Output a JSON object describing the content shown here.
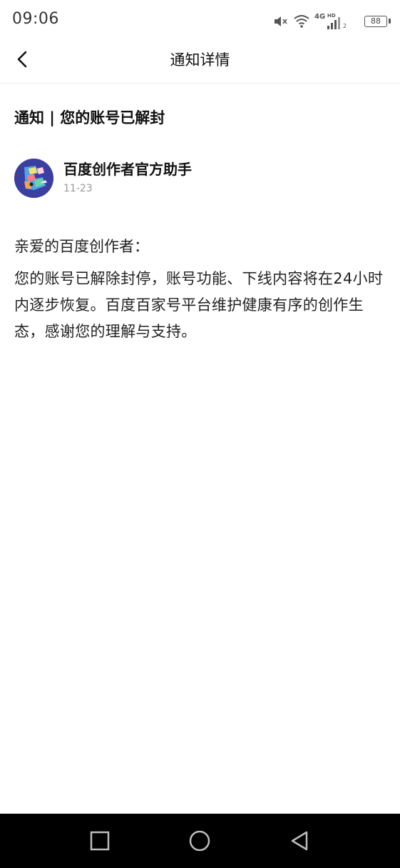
{
  "status_bar": {
    "time": "09:06",
    "network": "4G",
    "hd_label": "HD",
    "sim_slot": "2",
    "battery": "88",
    "icons": [
      "mute-icon",
      "wifi-icon",
      "signal-icon",
      "battery-icon"
    ]
  },
  "header": {
    "title": "通知详情",
    "back_icon": "chevron-left-icon"
  },
  "notice": {
    "title": "通知 | 您的账号已解封",
    "sender": {
      "name": "百度创作者官方助手",
      "date": "11-23"
    },
    "greeting": "亲爱的百度创作者：",
    "body": "您的账号已解除封停，账号功能、下线内容将在24小时内逐步恢复。百度百家号平台维护健康有序的创作生态，感谢您的理解与支持。"
  },
  "system_nav": {
    "icons": [
      "recents-square-icon",
      "home-circle-icon",
      "back-triangle-icon"
    ]
  },
  "colors": {
    "background": "#ffffff",
    "text": "#111111",
    "muted": "#999999",
    "avatar_bg": "#3b3fa0",
    "system_nav_bg": "#000000"
  }
}
